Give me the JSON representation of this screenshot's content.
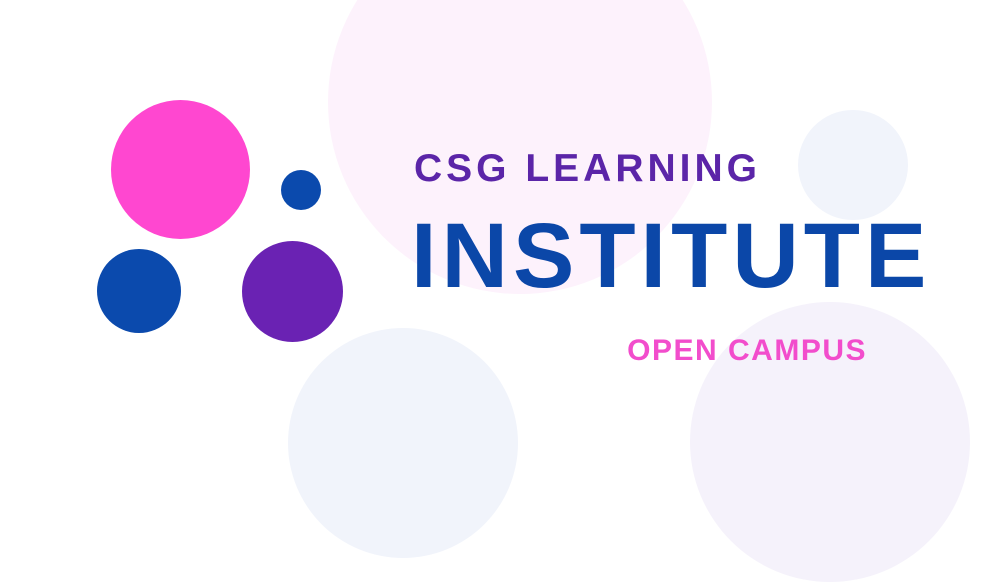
{
  "brand": {
    "line1": "CSG LEARNING",
    "line2": "INSTITUTE",
    "line3": "OPEN CAMPUS"
  },
  "colors": {
    "pink": "#ff47d0",
    "navy": "#0b4aad",
    "purple": "#6a22b3",
    "line1_text": "#5b25a8",
    "line2_text": "#0b47a8",
    "line3_text": "#f24dcc"
  },
  "icons": {
    "logo": "four-dots-logo-icon"
  }
}
